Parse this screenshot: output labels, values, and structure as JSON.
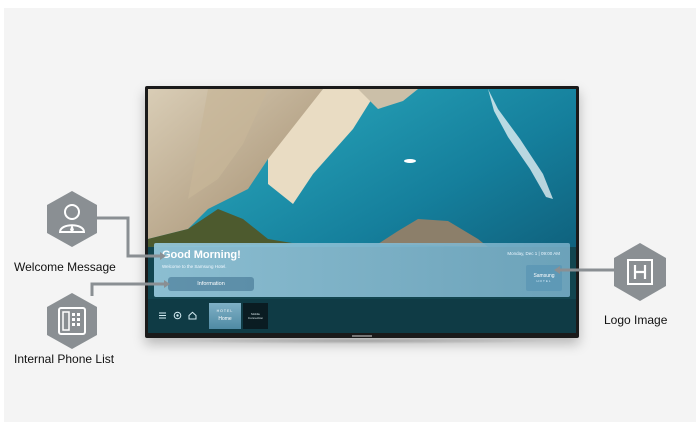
{
  "tv": {
    "greeting": "Good Morning!",
    "welcome_sub": "Welcome to the Samsung Hotel.",
    "datetime": "Monday, Dec 1 | 09:00 AM",
    "info_button": "Information",
    "logo_line1": "Samsung",
    "logo_line2": "HOTEL",
    "tiles": {
      "home_top": "HOTEL",
      "home_label": "Home",
      "mobile_label": "Mobile Connection"
    },
    "nav_icons": [
      "menu-icon",
      "source-icon",
      "home-icon"
    ]
  },
  "callouts": {
    "welcome": "Welcome Message",
    "phone": "Internal Phone List",
    "logo": "Logo Image"
  },
  "colors": {
    "hexagon": "#8a8f93",
    "connector": "#8a8f93",
    "screen_bar": "#0f3b45",
    "panel": "#88bfd6"
  }
}
